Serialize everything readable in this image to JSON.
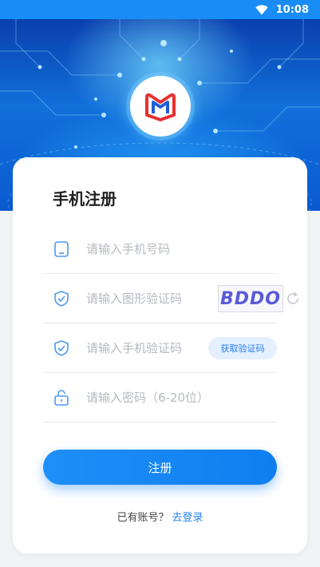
{
  "status_bar": {
    "time": "10:08",
    "wifi_icon": "wifi-icon"
  },
  "colors": {
    "primary": "#1a8cf5",
    "title": "#222222",
    "placeholder": "#b5b9c0",
    "link": "#2a86f0"
  },
  "page": {
    "title": "手机注册"
  },
  "form": {
    "phone_placeholder": "请输入手机号码",
    "captcha_placeholder": "请输入图形验证码",
    "captcha_text": "BDDO",
    "sms_placeholder": "请输入手机验证码",
    "get_code_label": "获取验证码",
    "password_placeholder": "请输入密码（6-20位）"
  },
  "actions": {
    "register_label": "注册"
  },
  "footer": {
    "have_account": "已有账号？",
    "login_link": "去登录"
  }
}
